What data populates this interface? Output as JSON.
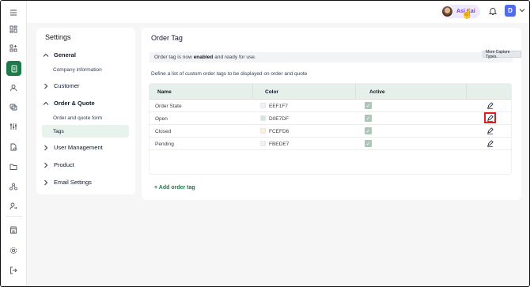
{
  "topbar": {
    "user_name": "Asi Kai",
    "avatar_letter": "D"
  },
  "rail": {
    "icons": [
      "menu-icon",
      "dashboard-icon",
      "apps-icon",
      "orders-icon",
      "user-icon",
      "tags-icon",
      "sliders-icon",
      "invoice-icon",
      "folder-icon",
      "network-icon",
      "user-switch-icon",
      "store-icon",
      "settings-icon",
      "logout-icon"
    ]
  },
  "settings": {
    "title": "Settings",
    "sections": [
      {
        "label": "General",
        "expanded": true,
        "items": [
          "Company information"
        ]
      },
      {
        "label": "Customer",
        "expanded": false,
        "items": []
      },
      {
        "label": "Order & Quote",
        "expanded": true,
        "items": [
          "Order and quote form",
          "Tags"
        ]
      },
      {
        "label": "User Management",
        "expanded": false,
        "items": []
      },
      {
        "label": "Product",
        "expanded": false,
        "items": []
      },
      {
        "label": "Email Settings",
        "expanded": false,
        "items": []
      }
    ],
    "active_item": "Tags"
  },
  "main": {
    "title": "Order Tag",
    "notice_prefix": "Order tag is now",
    "notice_bold": "enabled",
    "notice_suffix": "and ready for use.",
    "badge": "More Capture Types.",
    "description": "Define a list of custom order tags to be displayed on order and quote",
    "table": {
      "headers": [
        "Name",
        "Color",
        "Active"
      ],
      "rows": [
        {
          "name": "Order State",
          "color": "EEF1F7",
          "swatch": "#EEF1F7",
          "active": true
        },
        {
          "name": "Open",
          "color": "D0E7DF",
          "swatch": "#D0E7DF",
          "active": true
        },
        {
          "name": "Closed",
          "color": "FCEFD6",
          "swatch": "#FCEFD6",
          "active": true
        },
        {
          "name": "Pending",
          "color": "FBEDE7",
          "swatch": "#FBEDE7",
          "active": true
        }
      ],
      "highlighted_row": 1
    },
    "add_label": "+ Add order tag"
  },
  "colors": {
    "brand_green": "#1f7a4a",
    "highlight_red": "#e11d1d"
  }
}
